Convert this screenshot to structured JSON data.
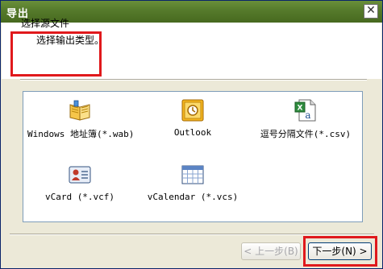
{
  "window": {
    "title": "导出",
    "close_glyph": "✕"
  },
  "header": {
    "title": "选择源文件",
    "subtitle": "选择输出类型。"
  },
  "items": [
    {
      "label": "Windows 地址簿(*.wab)",
      "icon": "address-book-icon"
    },
    {
      "label": "Outlook",
      "icon": "outlook-icon"
    },
    {
      "label": "逗号分隔文件(*.csv)",
      "icon": "csv-file-icon"
    },
    {
      "label": "vCard (*.vcf)",
      "icon": "vcard-icon"
    },
    {
      "label": "vCalendar (*.vcs)",
      "icon": "vcalendar-icon"
    }
  ],
  "buttons": {
    "prev_label": "< 上一步(B)",
    "next_label": "下一步(N) >"
  },
  "colors": {
    "titlebar": "#557a2b",
    "highlight": "#e0191c",
    "panel_border": "#7f9db9"
  }
}
